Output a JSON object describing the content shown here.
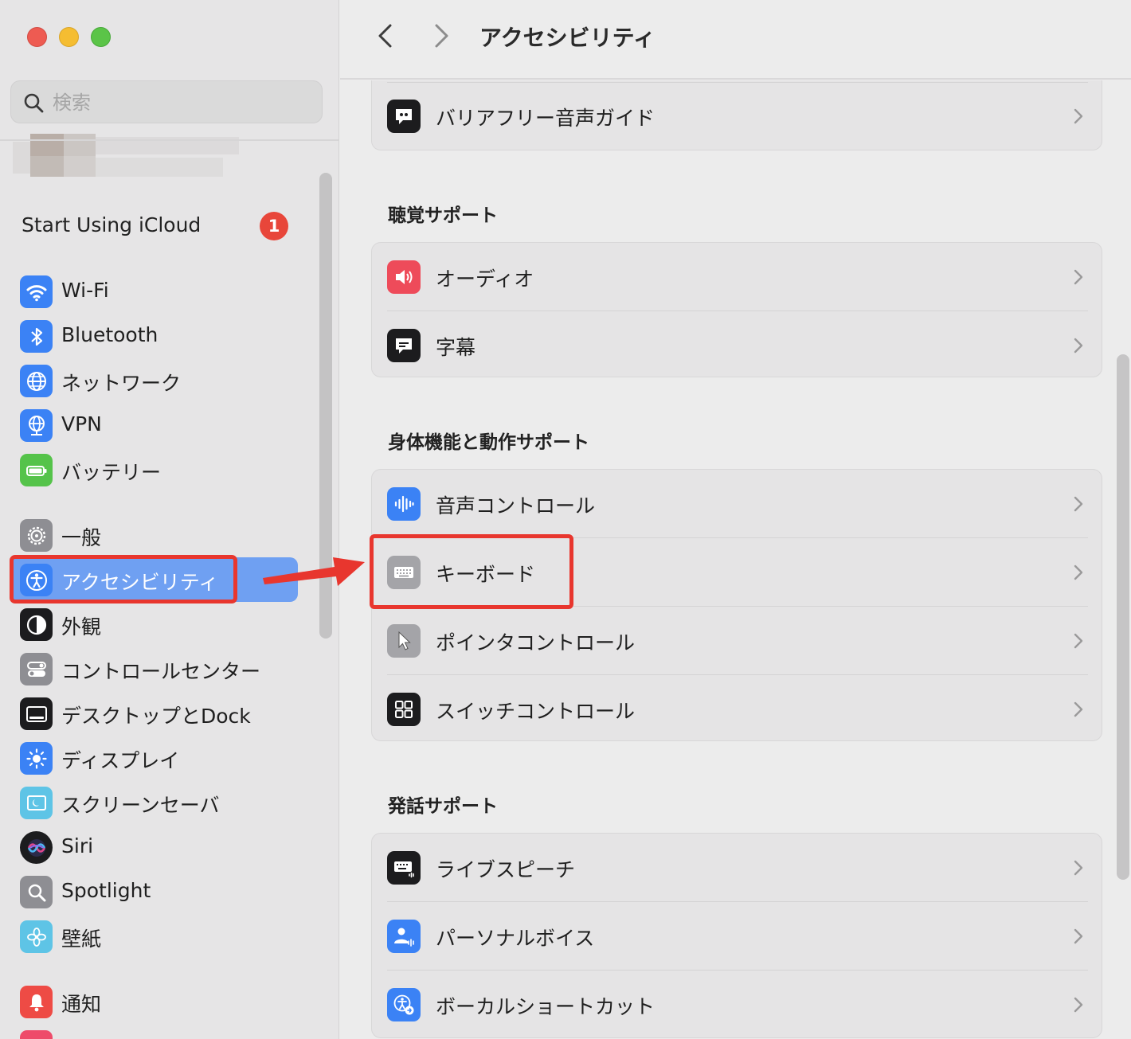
{
  "window": {
    "title": "アクセシビリティ"
  },
  "search": {
    "placeholder": "検索"
  },
  "account": {
    "label": "Start Using iCloud",
    "badge": "1"
  },
  "sidebar": {
    "items": [
      {
        "label": "Wi-Fi",
        "icon": "wifi-icon"
      },
      {
        "label": "Bluetooth",
        "icon": "bluetooth-icon"
      },
      {
        "label": "ネットワーク",
        "icon": "network-globe-icon"
      },
      {
        "label": "VPN",
        "icon": "vpn-globe-icon"
      },
      {
        "label": "バッテリー",
        "icon": "battery-icon"
      },
      {
        "label": "一般",
        "icon": "gear-icon"
      },
      {
        "label": "アクセシビリティ",
        "icon": "accessibility-icon",
        "selected": true
      },
      {
        "label": "外観",
        "icon": "appearance-icon"
      },
      {
        "label": "コントロールセンター",
        "icon": "control-center-icon"
      },
      {
        "label": "デスクトップとDock",
        "icon": "dock-icon"
      },
      {
        "label": "ディスプレイ",
        "icon": "display-sun-icon"
      },
      {
        "label": "スクリーンセーバ",
        "icon": "screensaver-icon"
      },
      {
        "label": "Siri",
        "icon": "siri-icon"
      },
      {
        "label": "Spotlight",
        "icon": "spotlight-icon"
      },
      {
        "label": "壁紙",
        "icon": "wallpaper-flower-icon"
      },
      {
        "label": "通知",
        "icon": "notification-bell-icon"
      }
    ]
  },
  "main": {
    "top_group": {
      "rows": [
        {
          "label": "バリアフリー音声ガイド",
          "icon": "audio-description-icon"
        }
      ]
    },
    "sections": [
      {
        "title": "聴覚サポート",
        "rows": [
          {
            "label": "オーディオ",
            "icon": "speaker-icon"
          },
          {
            "label": "字幕",
            "icon": "captions-icon"
          }
        ]
      },
      {
        "title": "身体機能と動作サポート",
        "rows": [
          {
            "label": "音声コントロール",
            "icon": "voice-control-icon"
          },
          {
            "label": "キーボード",
            "icon": "keyboard-icon"
          },
          {
            "label": "ポインタコントロール",
            "icon": "pointer-icon"
          },
          {
            "label": "スイッチコントロール",
            "icon": "switch-control-icon"
          }
        ]
      },
      {
        "title": "発話サポート",
        "rows": [
          {
            "label": "ライブスピーチ",
            "icon": "live-speech-icon"
          },
          {
            "label": "パーソナルボイス",
            "icon": "personal-voice-icon"
          },
          {
            "label": "ボーカルショートカット",
            "icon": "vocal-shortcuts-icon"
          }
        ]
      }
    ]
  },
  "colors": {
    "accent": "#6fa0f2",
    "annotation": "#e8362e",
    "badge": "#e8463a"
  }
}
